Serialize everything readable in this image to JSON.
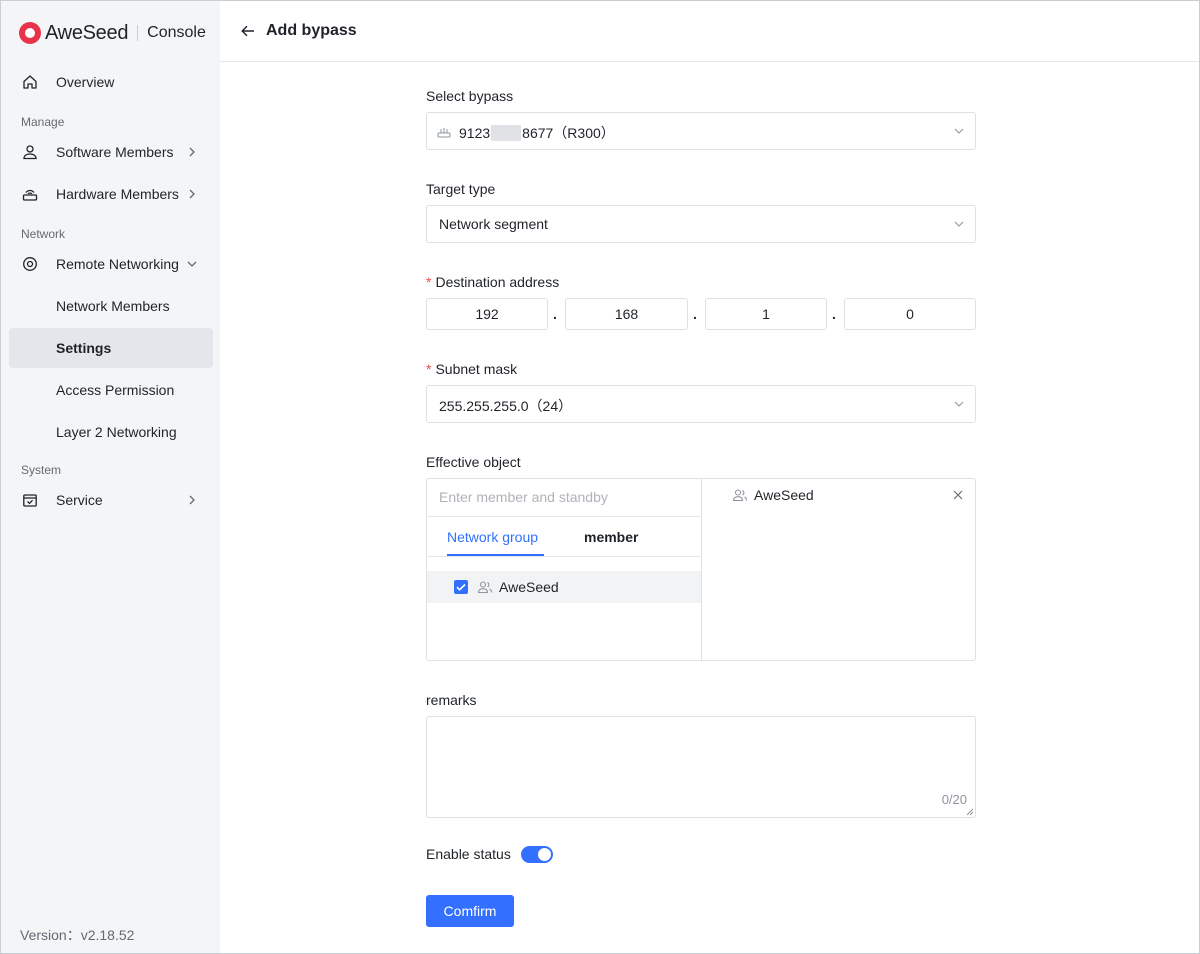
{
  "brand": {
    "name": "AweSeed",
    "console": "Console"
  },
  "sidebar": {
    "overview": "Overview",
    "section_manage": "Manage",
    "software_members": "Software Members",
    "hardware_members": "Hardware Members",
    "section_network": "Network",
    "remote_networking": "Remote Networking",
    "network_members": "Network Members",
    "settings": "Settings",
    "access_permission": "Access Permission",
    "layer2_networking": "Layer 2 Networking",
    "section_system": "System",
    "service": "Service",
    "version": "Version：v2.18.52"
  },
  "header": {
    "title": "Add bypass"
  },
  "form": {
    "select_bypass_label": "Select bypass",
    "bypass_prefix": "9123",
    "bypass_suffix": "8677（R300）",
    "target_type_label": "Target type",
    "target_type_value": "Network segment",
    "destination_label": "Destination address",
    "ip": [
      "192",
      "168",
      "1",
      "0"
    ],
    "subnet_label": "Subnet mask",
    "subnet_value": "255.255.255.0（24）",
    "effective_label": "Effective object",
    "search_placeholder": "Enter member and standby",
    "tab_group": "Network group",
    "tab_member": "member",
    "group_item": "AweSeed",
    "selected_item": "AweSeed",
    "remarks_label": "remarks",
    "remarks_counter": "0/20",
    "enable_label": "Enable status",
    "enable_value": true,
    "confirm": "Comfirm"
  },
  "colors": {
    "accent": "#3370ff",
    "required": "#f54a45",
    "brand": "#e8334a"
  }
}
